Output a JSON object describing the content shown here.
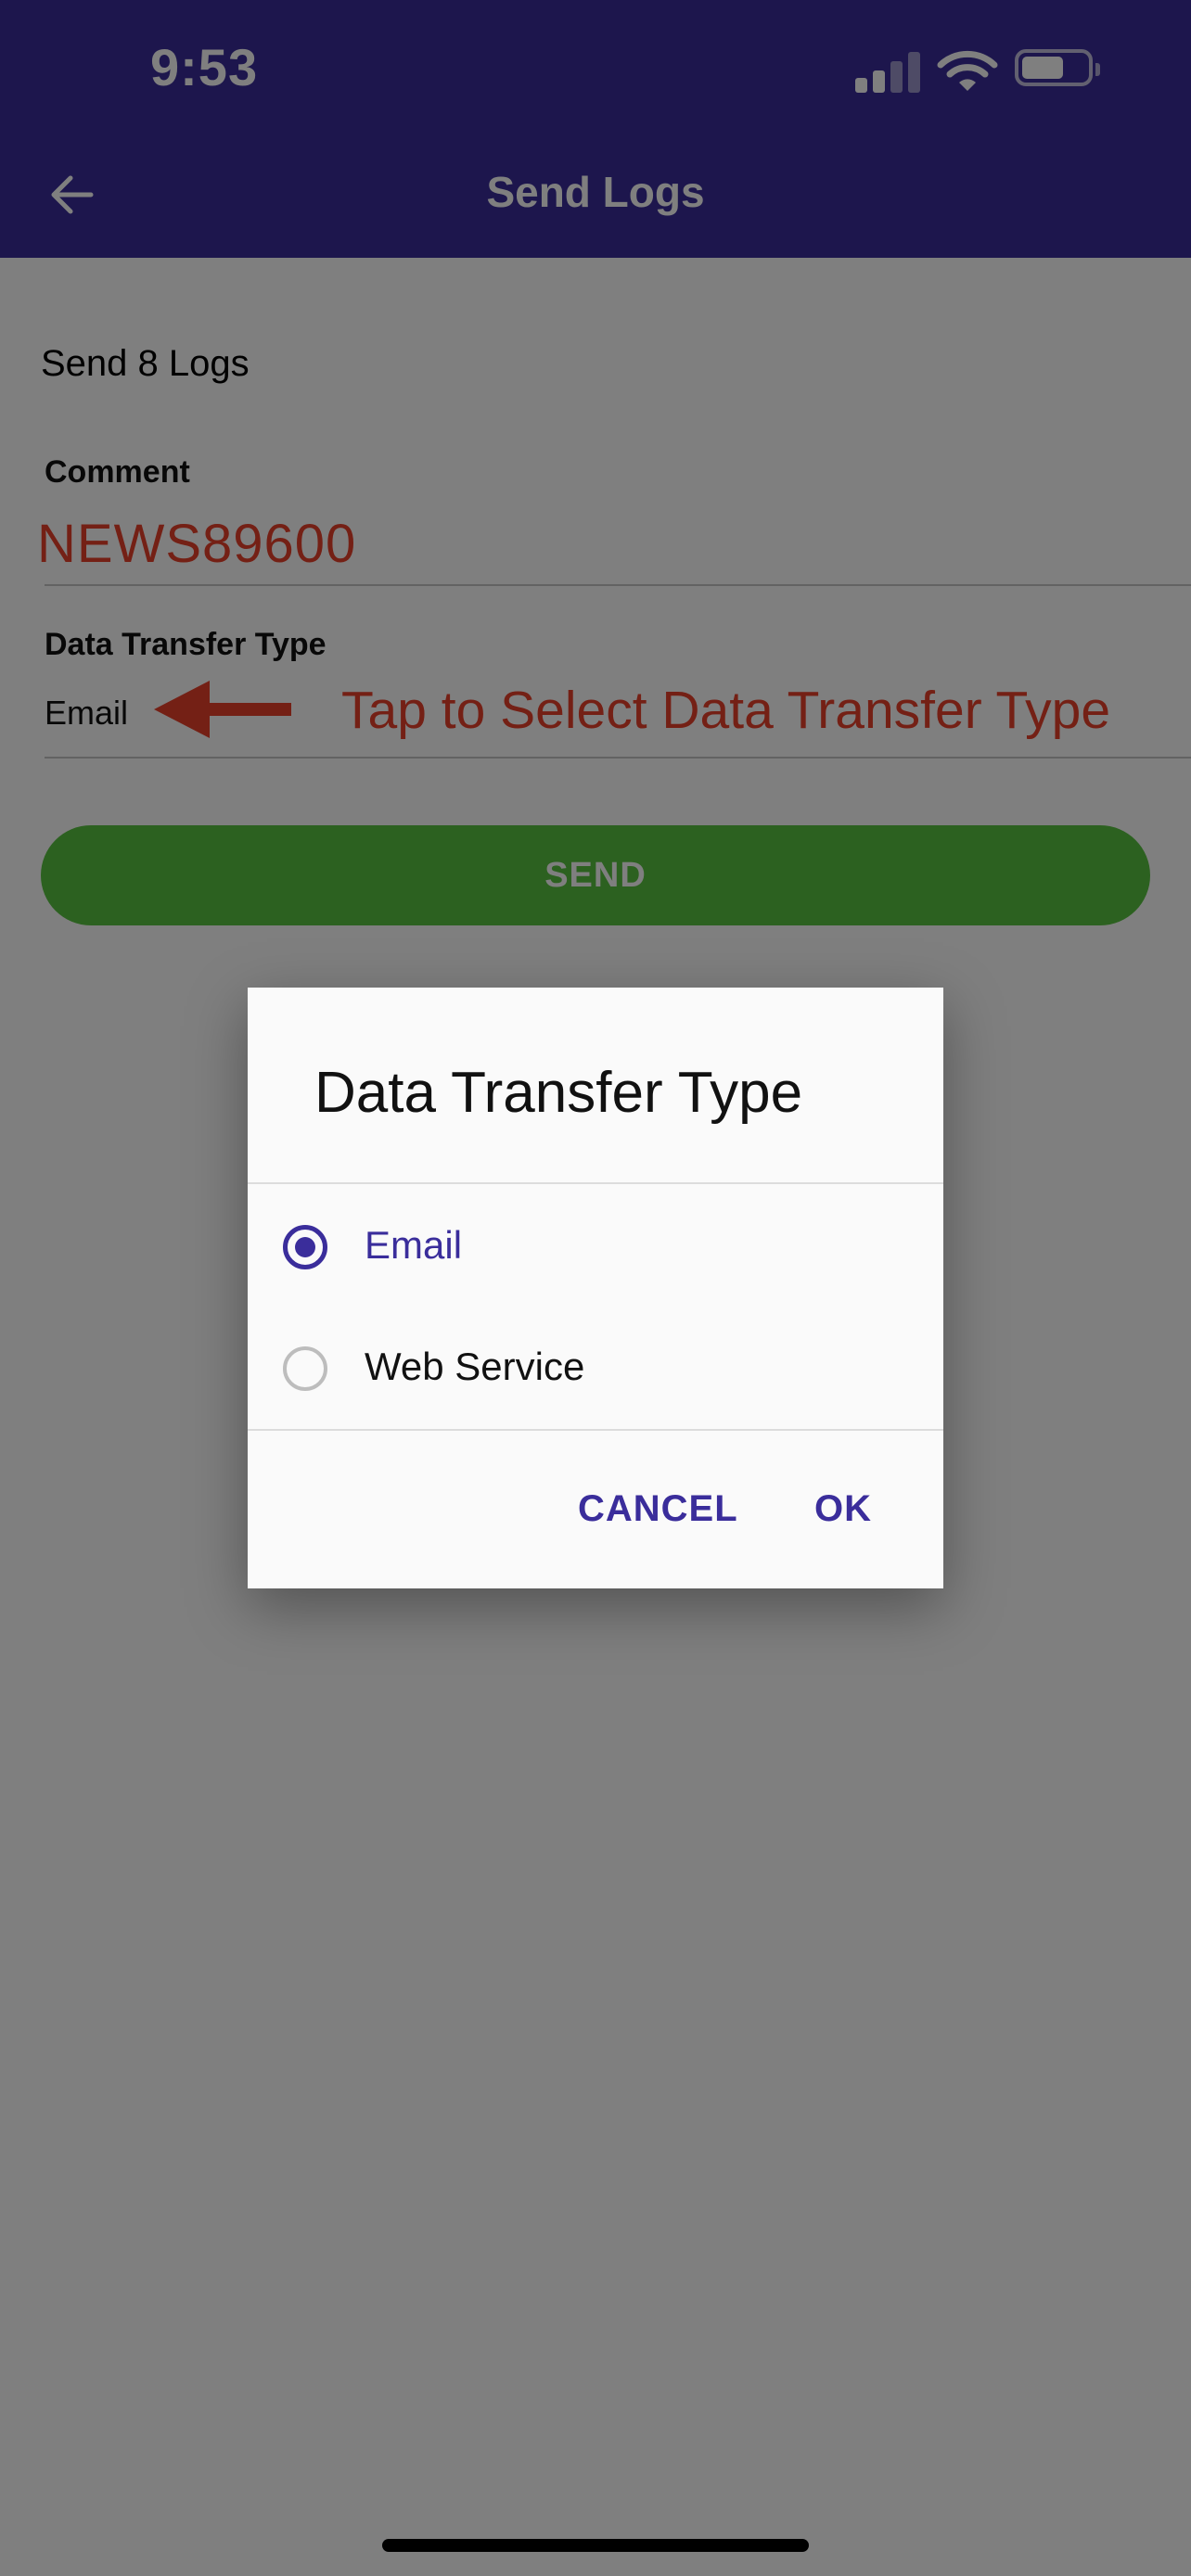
{
  "status_bar": {
    "time": "9:53"
  },
  "nav": {
    "title": "Send Logs",
    "back_icon": "arrow-left-icon"
  },
  "form": {
    "send_count_text": "Send 8 Logs",
    "comment_label": "Comment",
    "comment_value": "NEWS89600",
    "transfer_type_label": "Data Transfer Type",
    "transfer_type_value": "Email",
    "annotation_text": "Tap to Select Data Transfer Type",
    "send_button": "SEND"
  },
  "dialog": {
    "title": "Data Transfer Type",
    "options": [
      {
        "label": "Email",
        "selected": true
      },
      {
        "label": "Web Service",
        "selected": false
      }
    ],
    "cancel_label": "CANCEL",
    "ok_label": "OK"
  },
  "colors": {
    "header": "#3a2d9b",
    "accent": "#3a2d9b",
    "send_button": "#59c241",
    "annotation": "#e8402a"
  }
}
